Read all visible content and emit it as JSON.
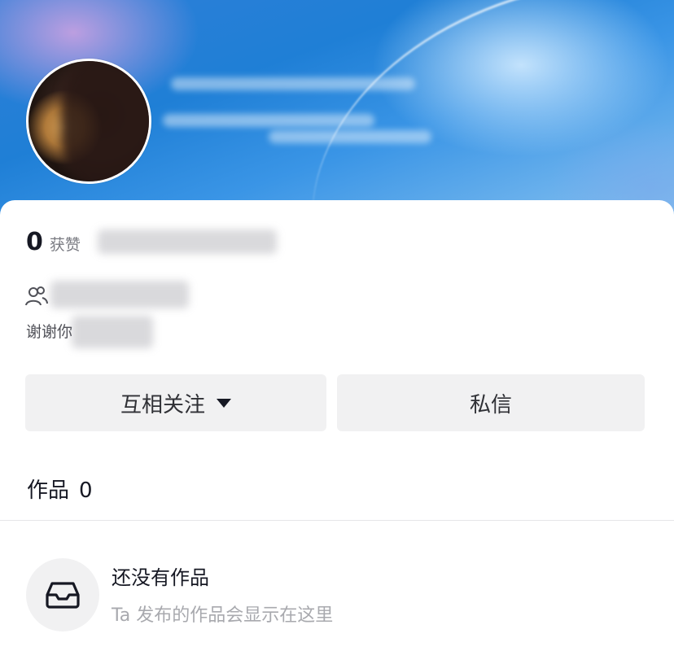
{
  "profile": {
    "likes_count": "0",
    "likes_label": "获赞",
    "bio_visible": "谢谢你"
  },
  "actions": {
    "follow_label": "互相关注",
    "message_label": "私信"
  },
  "works": {
    "title": "作品",
    "count": "0"
  },
  "empty_state": {
    "title": "还没有作品",
    "subtitle": "Ta 发布的作品会显示在这里",
    "icon": "inbox-icon"
  },
  "colors": {
    "button_bg": "#f1f1f2",
    "text_primary": "#161823",
    "text_secondary": "#a8a9ae"
  }
}
